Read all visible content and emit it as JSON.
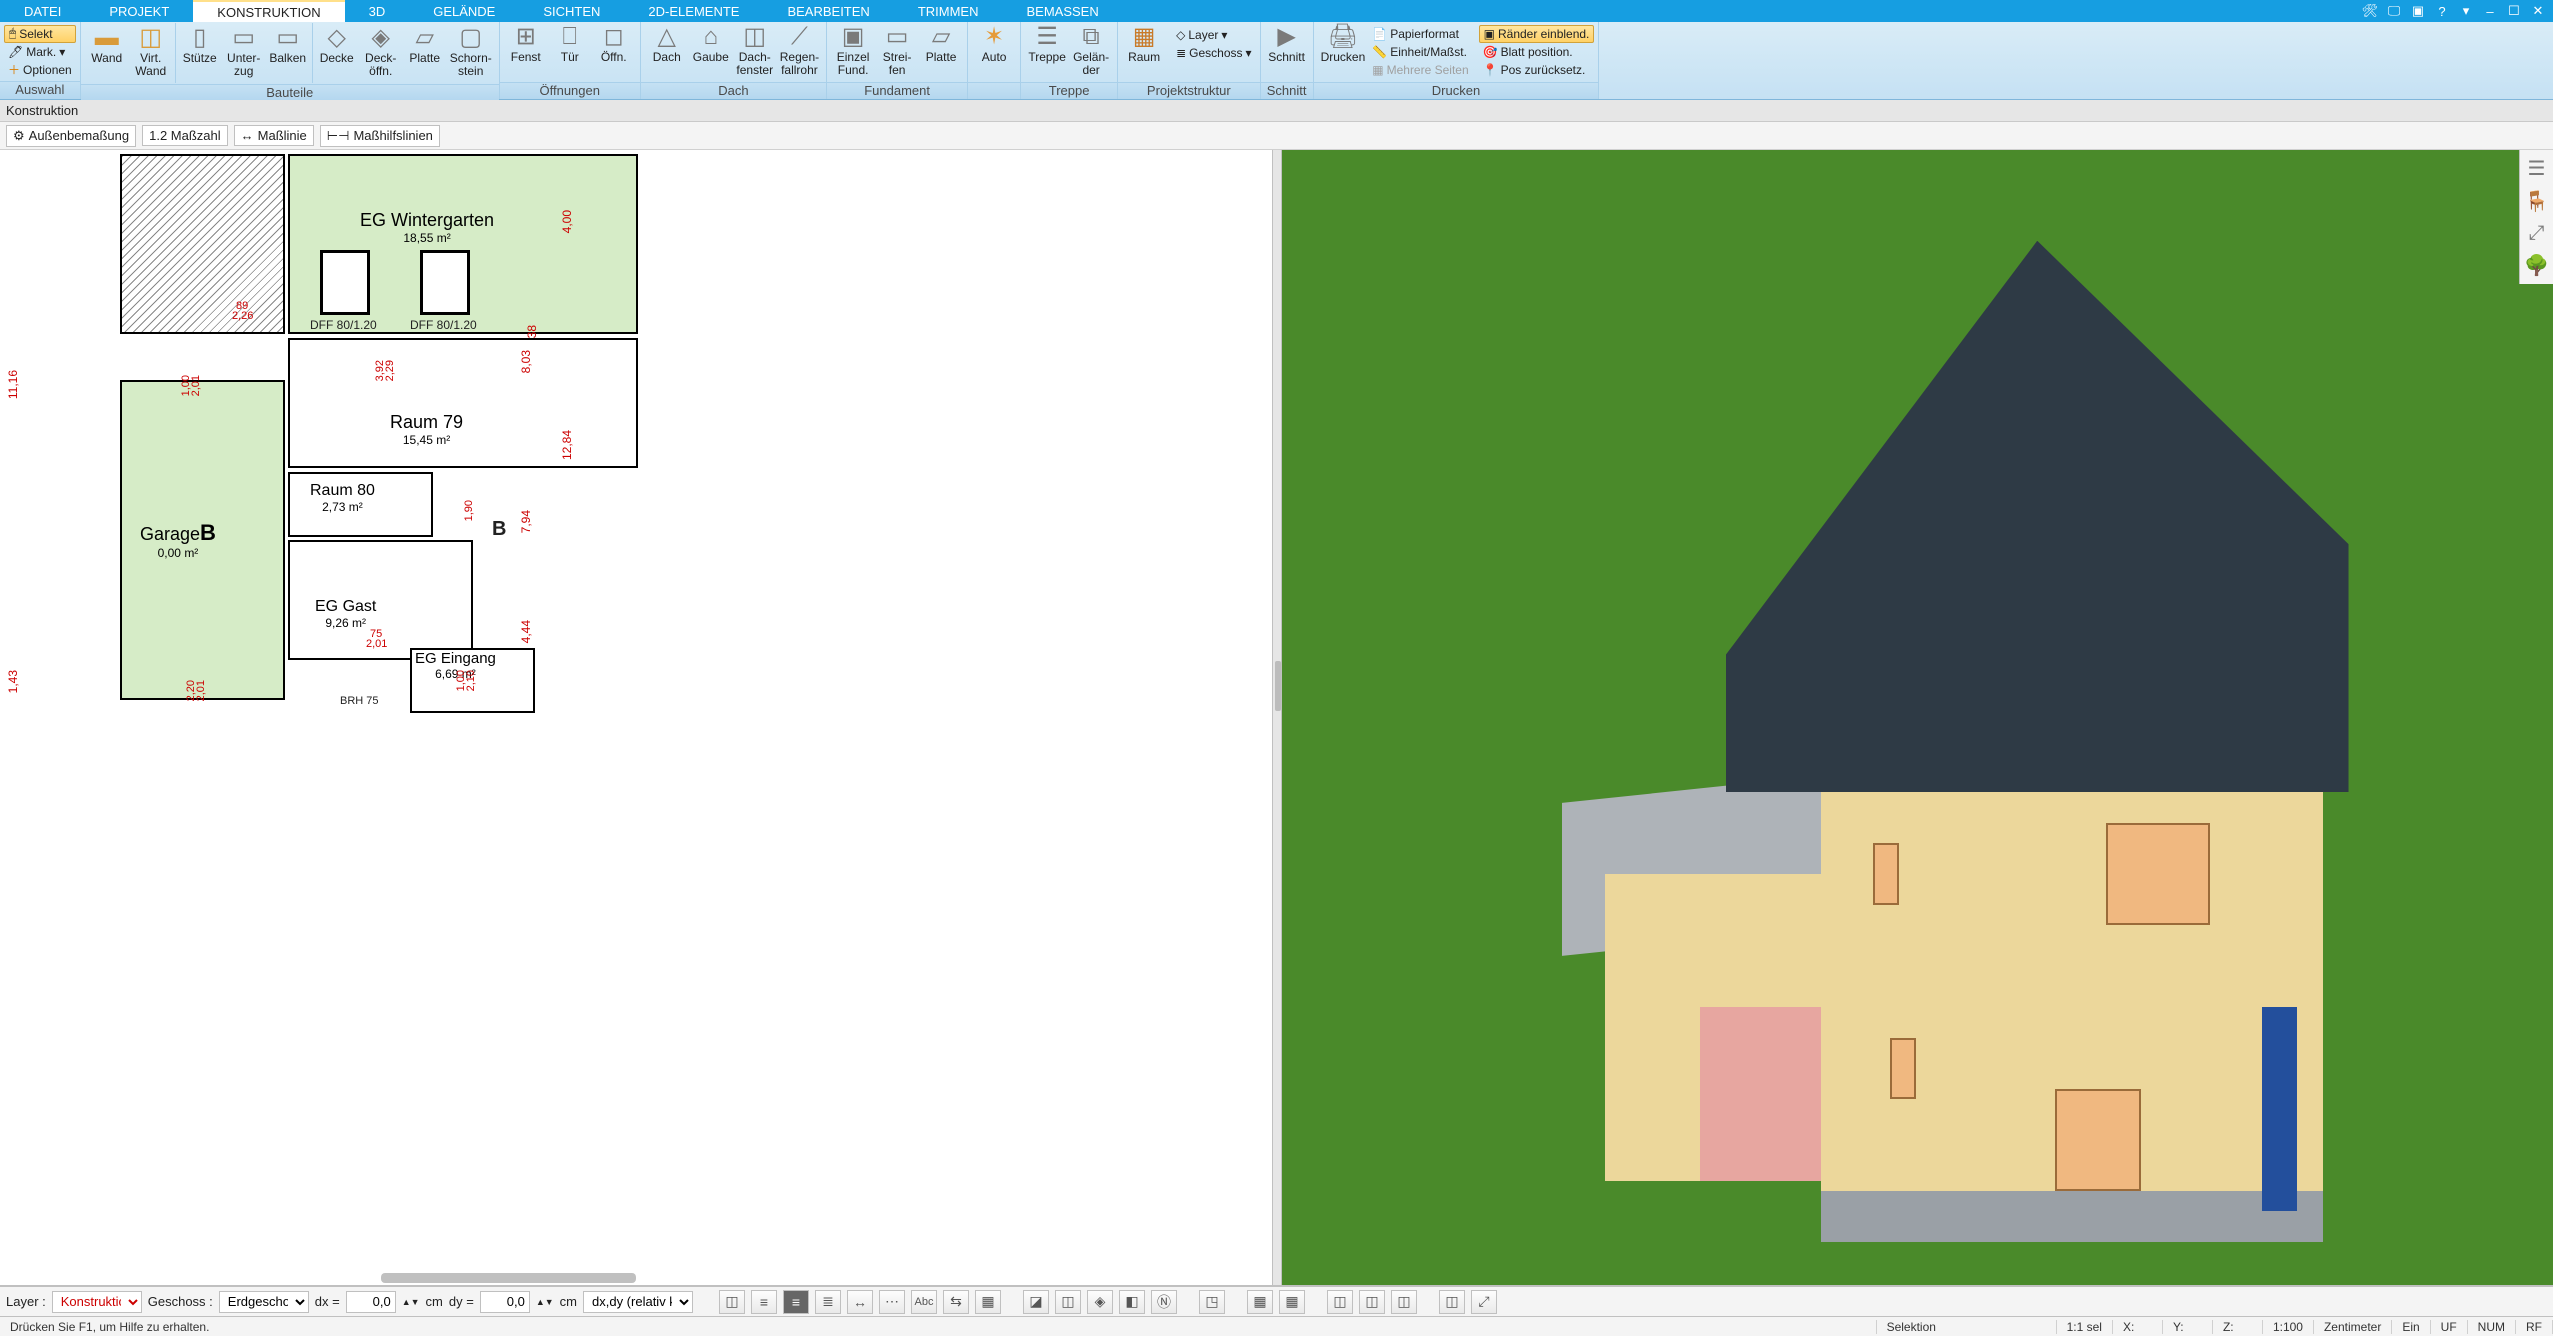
{
  "tabs": [
    "DATEI",
    "PROJEKT",
    "KONSTRUKTION",
    "3D",
    "GELÄNDE",
    "SICHTEN",
    "2D-ELEMENTE",
    "BEARBEITEN",
    "TRIMMEN",
    "BEMASSEN"
  ],
  "active_tab": "KONSTRUKTION",
  "ribbon": {
    "auswahl": {
      "selekt": "Selekt",
      "mark": "Mark.",
      "optionen": "Optionen",
      "caption": "Auswahl"
    },
    "bauteile": {
      "wand": "Wand",
      "virt_wand": "Virt.\nWand",
      "stuetze": "Stütze",
      "unterzug": "Unter-\nzug",
      "balken": "Balken",
      "decke": "Decke",
      "deckoeffn": "Deck-\nöffn.",
      "platte": "Platte",
      "schornstein": "Schorn-\nstein",
      "caption": "Bauteile"
    },
    "oeffnungen": {
      "fenst": "Fenst",
      "tuer": "Tür",
      "oeffn": "Öffn.",
      "caption": "Öffnungen"
    },
    "dach": {
      "dach": "Dach",
      "gaube": "Gaube",
      "dachfenster": "Dach-\nfenster",
      "regenfallrohr": "Regen-\nfallrohr",
      "caption": "Dach"
    },
    "fundament": {
      "einzelfund": "Einzel\nFund.",
      "streifen": "Strei-\nfen",
      "platte": "Platte",
      "caption": "Fundament"
    },
    "auto": {
      "auto": "Auto",
      "caption": ""
    },
    "treppe": {
      "treppe": "Treppe",
      "gelaender": "Gelän-\nder",
      "caption": "Treppe"
    },
    "projektstruktur": {
      "raum": "Raum",
      "layer": "Layer",
      "geschoss": "Geschoss",
      "caption": "Projektstruktur"
    },
    "schnitt": {
      "schnitt": "Schnitt",
      "caption": "Schnitt"
    },
    "drucken": {
      "drucken": "Drucken",
      "papierformat": "Papierformat",
      "einheit": "Einheit/Maßst.",
      "mehrere": "Mehrere Seiten",
      "raender": "Ränder einblend.",
      "blatt": "Blatt position.",
      "pos_reset": "Pos zurücksetz.",
      "caption": "Drucken"
    }
  },
  "crumb": "Konstruktion",
  "subtoolbar": {
    "aussen": "Außenbemaßung",
    "masszahl": "1.2 Maßzahl",
    "masslinie": "Maßlinie",
    "masshilf": "Maßhilfslinien"
  },
  "plan2d": {
    "rooms": {
      "wintergarten": {
        "name": "EG Wintergarten",
        "area": "18,55 m²"
      },
      "raum79": {
        "name": "Raum 79",
        "area": "15,45 m²"
      },
      "raum80": {
        "name": "Raum 80",
        "area": "2,73 m²"
      },
      "garage": {
        "name": "Garage",
        "area": "0,00 m²",
        "sect": "B"
      },
      "gast": {
        "name": "EG Gast",
        "area": "9,26 m²"
      },
      "eingang": {
        "name": "EG Eingang",
        "area": "6,69 m²"
      },
      "sectRight": "B"
    },
    "labels": {
      "dff1": "DFF  80/1.20",
      "dff2": "DFF  80/1.20",
      "brh": "BRH 75"
    },
    "dims": {
      "left_1": "11,16",
      "left_2": "1,43",
      "leftInner_89": "89",
      "leftInner_226": "2,26",
      "right_top": "4,00",
      "right_mid": "12,84",
      "right_803": "8,03",
      "right_38": "38",
      "right_794": "7,94",
      "right_444": "4,44",
      "mid_392": "3,92",
      "mid_229": "2,29",
      "door_75": "75",
      "door_201": "2,01",
      "door_190": "1,90",
      "door_100": "1,00",
      "door_210": "2,10",
      "gar_220": "2,20",
      "gar_201": "2,01",
      "gar_100": "1,00",
      "gar_201b": "2,01"
    }
  },
  "cmdbar": {
    "layer_label": "Layer :",
    "layer_value": "Konstruktio",
    "geschoss_label": "Geschoss :",
    "geschoss_value": "Erdgeschos",
    "dx_label": "dx =",
    "dx_value": "0,0",
    "dy_label": "dy =",
    "dy_value": "0,0",
    "unit": "cm",
    "mode": "dx,dy (relativ ka"
  },
  "status": {
    "hint": "Drücken Sie F1, um Hilfe zu erhalten.",
    "selektion": "Selektion",
    "sel": "1:1 sel",
    "x": "X:",
    "y": "Y:",
    "z": "Z:",
    "scale": "1:100",
    "unit": "Zentimeter",
    "ein": "Ein",
    "uf": "UF",
    "num": "NUM",
    "rf": "RF"
  }
}
